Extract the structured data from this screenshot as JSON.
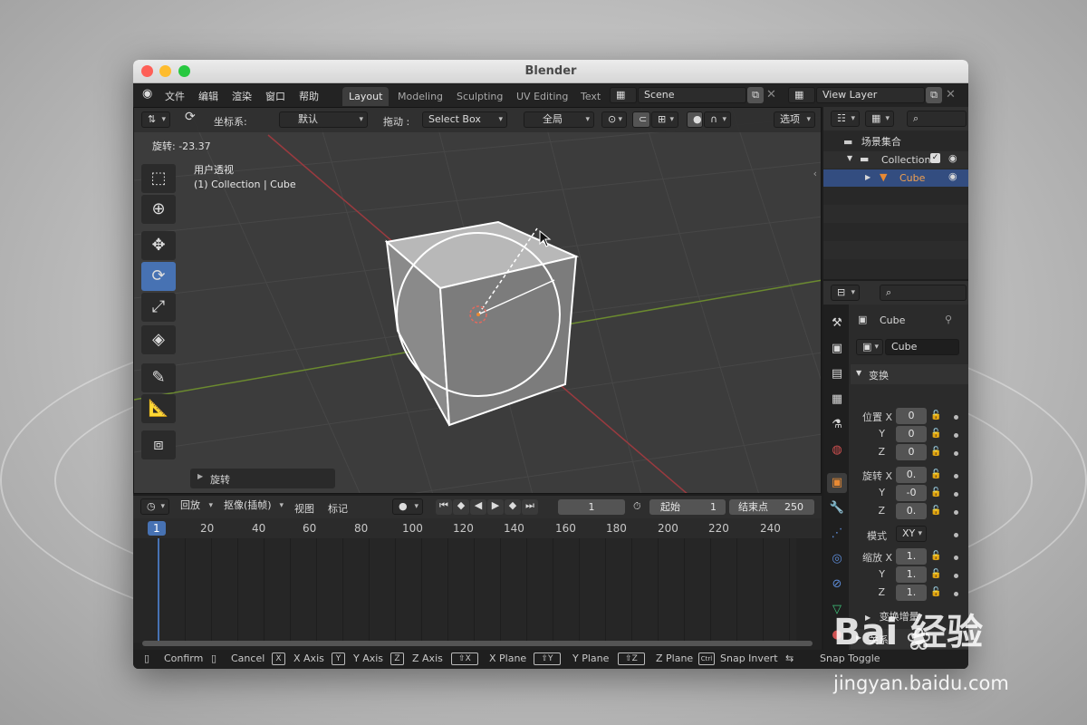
{
  "window": {
    "title": "Blender"
  },
  "menu": [
    "文件",
    "编辑",
    "渲染",
    "窗口",
    "帮助"
  ],
  "workspaces": [
    {
      "label": "Layout",
      "active": true
    },
    {
      "label": "Modeling",
      "active": false
    },
    {
      "label": "Sculpting",
      "active": false
    },
    {
      "label": "UV Editing",
      "active": false
    },
    {
      "label": "Text",
      "active": false
    }
  ],
  "scene_field": "Scene",
  "view_layer_field": "View Layer",
  "viewport": {
    "coord_label": "坐标系:",
    "coord_value": "默认",
    "drag_label": "拖动 :",
    "drag_value": "Select Box",
    "transform_orient": "全局",
    "options_label": "选项",
    "rotation_readout": "旋转: -23.37",
    "view_name": "用户透视",
    "collection_info": "(1) Collection | Cube",
    "last_op_panel": "旋转"
  },
  "outliner": {
    "scene_collection": "场景集合",
    "collection": "Collection",
    "object": "Cube"
  },
  "properties": {
    "object_name": "Cube",
    "data_name": "Cube",
    "transform_header": "变换",
    "location_label": "位置 X",
    "rotation_label": "旋转 X",
    "mode_label": "模式",
    "mode_value": "XY",
    "scale_label": "缩放 X",
    "axis_y": "Y",
    "axis_z": "Z",
    "location": [
      "0",
      "0",
      "0"
    ],
    "rotation": [
      "0.",
      "-0",
      "0."
    ],
    "scale": [
      "1.",
      "1.",
      "1."
    ],
    "delta_transform": "变换增量",
    "relations": "关系"
  },
  "timeline": {
    "playback": "回放",
    "keying": "抠像(插帧)",
    "view": "视图",
    "marker": "标记",
    "current_frame": "1",
    "start_label": "起始",
    "start_value": "1",
    "end_label": "结束点",
    "end_value": "250",
    "ruler": [
      "1",
      "20",
      "40",
      "60",
      "80",
      "100",
      "120",
      "140",
      "160",
      "180",
      "200",
      "220",
      "240"
    ]
  },
  "statusbar": [
    {
      "key": "",
      "label": "Confirm"
    },
    {
      "key": "",
      "label": "Cancel"
    },
    {
      "key": "X",
      "label": "X Axis"
    },
    {
      "key": "Y",
      "label": "Y Axis"
    },
    {
      "key": "Z",
      "label": "Z Axis"
    },
    {
      "key": "⇧X",
      "label": "X Plane"
    },
    {
      "key": "⇧Y",
      "label": "Y Plane"
    },
    {
      "key": "⇧Z",
      "label": "Z Plane"
    },
    {
      "key": "Ctrl",
      "label": "Snap Invert"
    },
    {
      "key": "",
      "label": "Snap Toggle"
    }
  ],
  "watermark": {
    "brand": "Bai 经验",
    "url": "jingyan.baidu.com"
  },
  "colors": {
    "accent": "#4772b3",
    "selection": "#e88a34",
    "background": "#3c3c3c"
  }
}
